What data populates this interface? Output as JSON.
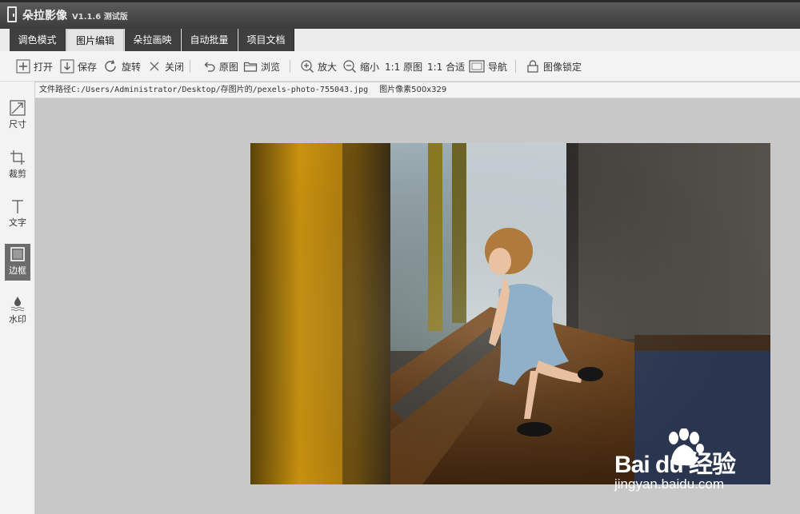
{
  "app": {
    "name": "朵拉影像",
    "version": "V1.1.6 测试版"
  },
  "tabs": [
    {
      "label": "调色模式"
    },
    {
      "label": "图片编辑"
    },
    {
      "label": "朵拉画映"
    },
    {
      "label": "自动批量"
    },
    {
      "label": "项目文档"
    }
  ],
  "toolbar": {
    "open": "打开",
    "save": "保存",
    "rotate": "旋转",
    "close": "关闭",
    "original": "原图",
    "browse": "浏览",
    "zoom_in": "放大",
    "zoom_out": "缩小",
    "one_to_one": "1:1 原图",
    "fit": "1:1 合适",
    "navigator": "导航",
    "lock": "图像锁定"
  },
  "sidebar": {
    "items": [
      {
        "label": "尺寸"
      },
      {
        "label": "裁剪"
      },
      {
        "label": "文字"
      },
      {
        "label": "边框"
      },
      {
        "label": "水印"
      }
    ]
  },
  "info": {
    "path": "文件路径C:/Users/Administrator/Desktop/存图片的/pexels-photo-755043.jpg",
    "size": "图片像素500x329"
  },
  "watermark": {
    "main": "Bai du 经验",
    "sub": "jingyan.baidu.com"
  }
}
